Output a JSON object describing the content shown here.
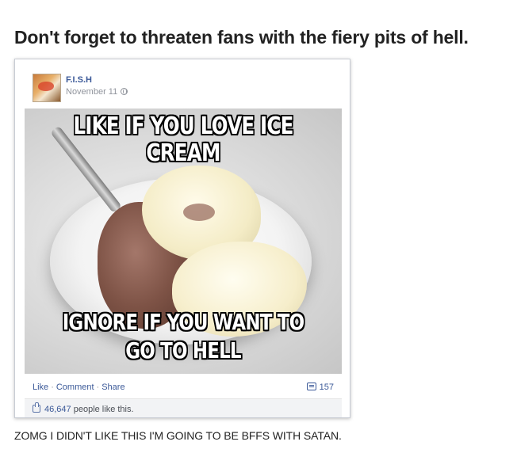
{
  "headline": "Don't forget to threaten fans with the fiery pits of hell.",
  "post": {
    "page_name": "F.I.S.H",
    "date": "November 11",
    "meme_top_text": "LIKE IF YOU LOVE ICE CREAM",
    "meme_bottom_line1": "IGNORE IF YOU WANT TO",
    "meme_bottom_line2": "GO TO HELL",
    "actions": {
      "like": "Like",
      "comment": "Comment",
      "share": "Share",
      "separator": "·",
      "comment_count": "157"
    },
    "likes": {
      "count": "46,647",
      "text": "people like this."
    }
  },
  "caption": "ZOMG I DIDN'T LIKE THIS I'M GOING TO BE BFFS WITH SATAN.",
  "colors": {
    "link_blue": "#3b5998",
    "muted_gray": "#90949c",
    "likes_bar_bg": "#f2f3f5"
  },
  "icons": [
    "globe-icon",
    "comment-icon",
    "thumbs-up-icon"
  ]
}
